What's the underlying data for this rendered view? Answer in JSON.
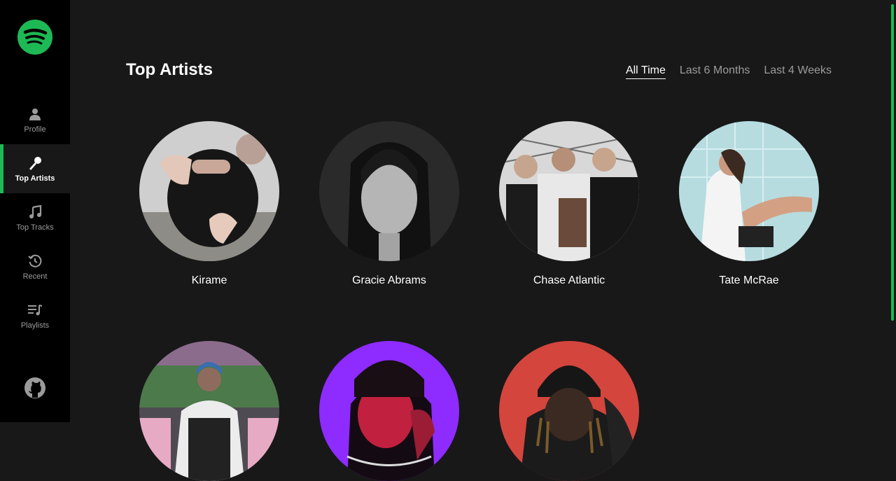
{
  "sidebar": {
    "logo": "spotify-logo",
    "items": [
      {
        "label": "Profile",
        "icon": "user-icon"
      },
      {
        "label": "Top Artists",
        "icon": "microphone-icon"
      },
      {
        "label": "Top Tracks",
        "icon": "music-note-icon"
      },
      {
        "label": "Recent",
        "icon": "history-icon"
      },
      {
        "label": "Playlists",
        "icon": "playlist-icon"
      }
    ],
    "footer_icon": "github-icon"
  },
  "main": {
    "title": "Top Artists",
    "ranges": [
      {
        "label": "All Time",
        "active": true
      },
      {
        "label": "Last 6 Months",
        "active": false
      },
      {
        "label": "Last 4 Weeks",
        "active": false
      }
    ],
    "artists": [
      {
        "name": "Kirame"
      },
      {
        "name": "Gracie Abrams"
      },
      {
        "name": "Chase Atlantic"
      },
      {
        "name": "Tate McRae"
      },
      {
        "name": ""
      },
      {
        "name": ""
      },
      {
        "name": ""
      }
    ]
  },
  "colors": {
    "accent": "#1db954",
    "background": "#181818",
    "sidebar": "#000000"
  }
}
